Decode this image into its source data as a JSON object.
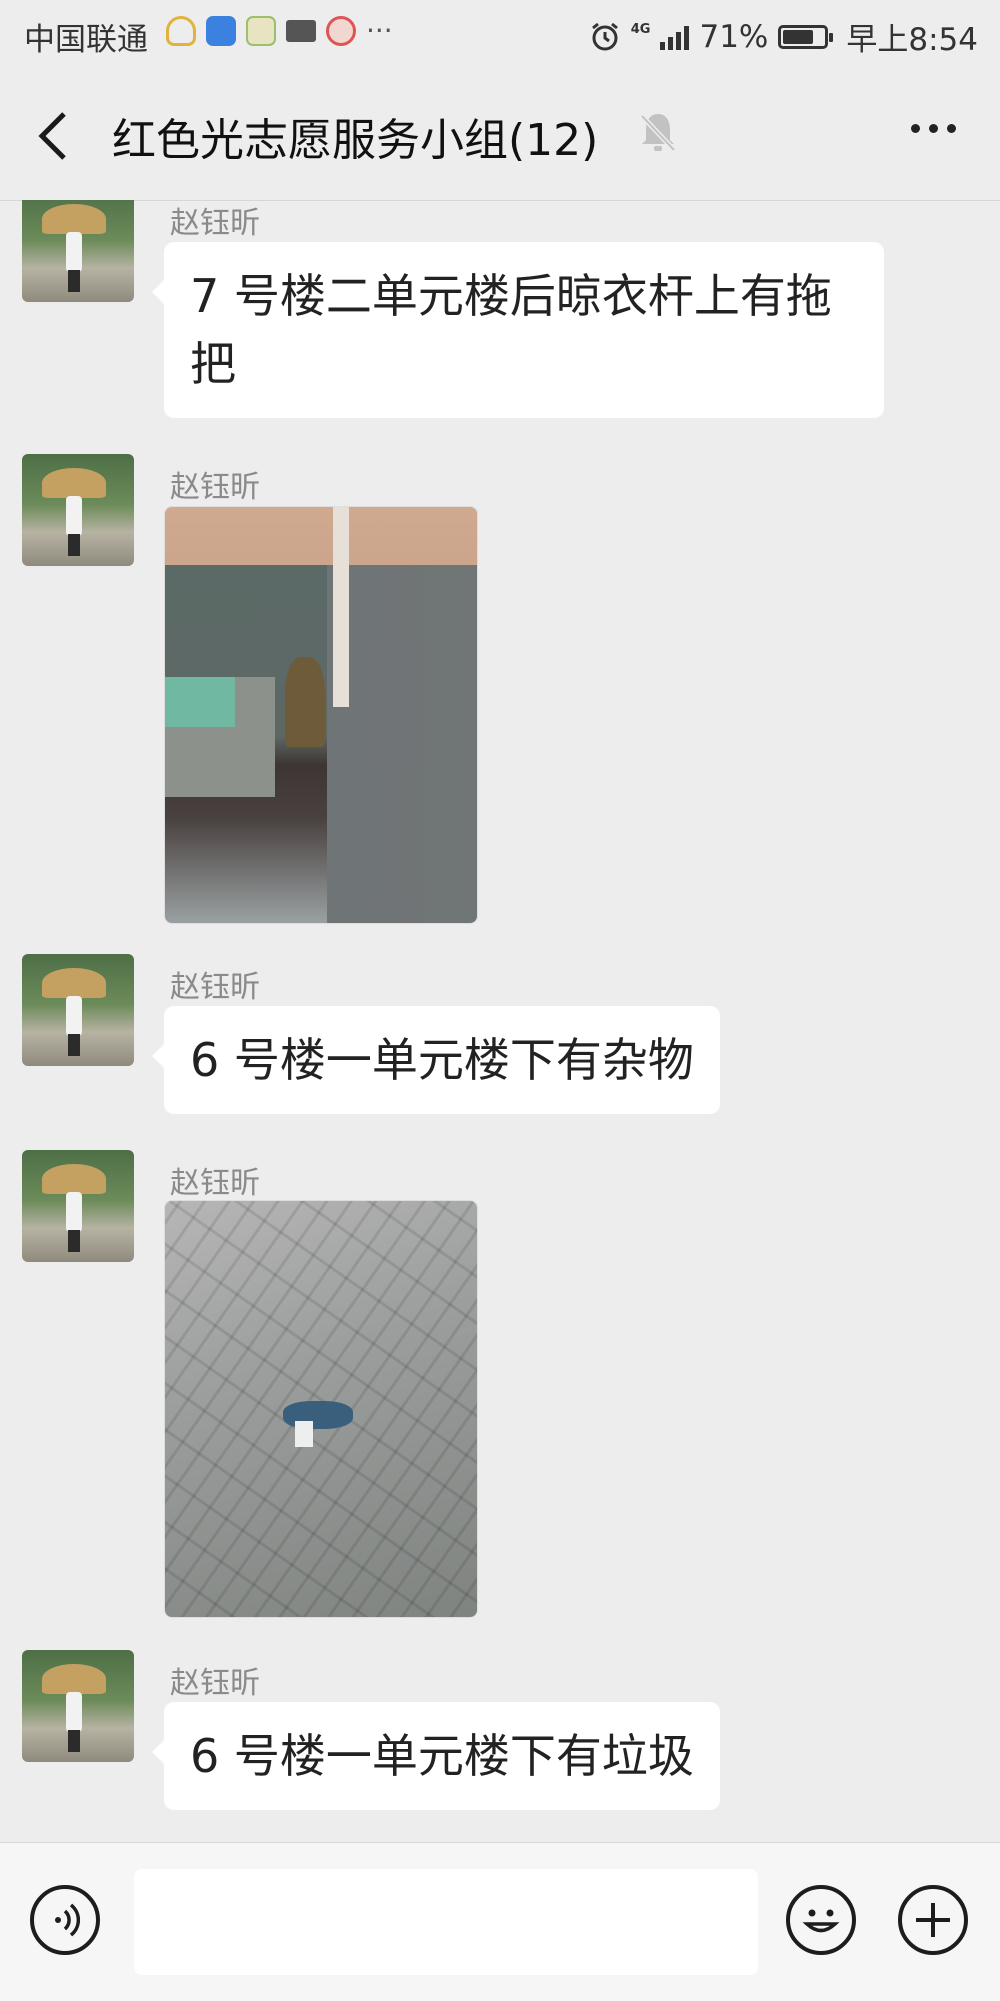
{
  "status_bar": {
    "carrier": "中国联通",
    "network": "4G",
    "battery": "71%",
    "time": "早上8:54",
    "more": "···"
  },
  "header": {
    "title": "红色光志愿服务小组(12)",
    "muted": true
  },
  "messages": [
    {
      "sender": "赵钰昕",
      "type": "text",
      "text": "7 号楼二单元楼后晾衣杆上有拖把"
    },
    {
      "sender": "赵钰昕",
      "type": "image"
    },
    {
      "sender": "赵钰昕",
      "type": "text",
      "text": "6 号楼一单元楼下有杂物"
    },
    {
      "sender": "赵钰昕",
      "type": "image"
    },
    {
      "sender": "赵钰昕",
      "type": "text",
      "text": "6 号楼一单元楼下有垃圾"
    }
  ],
  "colors": {
    "background": "#ededed",
    "bubble": "#ffffff",
    "sender_name": "#8a8a8a"
  }
}
